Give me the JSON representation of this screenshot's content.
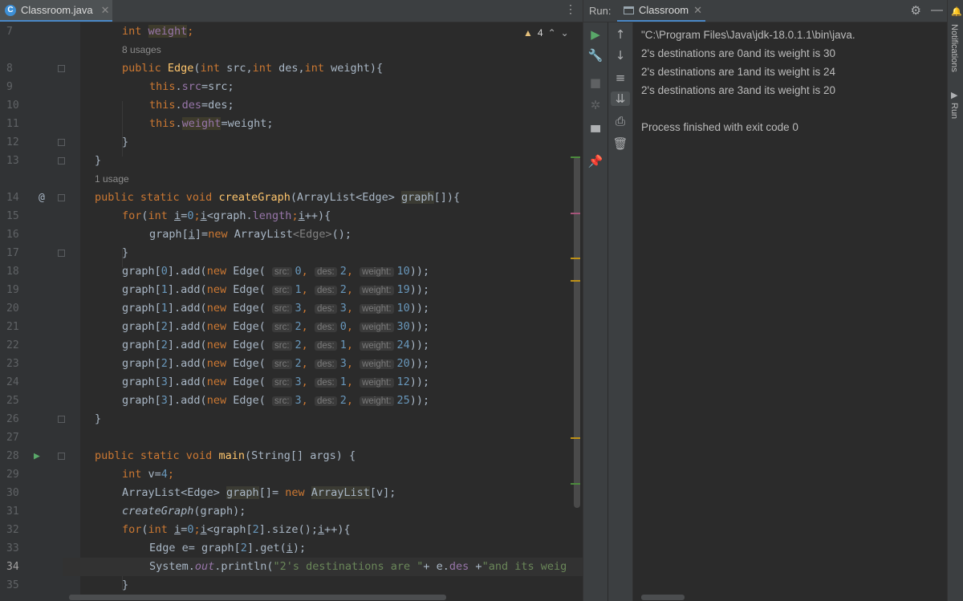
{
  "editor": {
    "tab_label": "Classroom.java",
    "tab_icon": "c-class-icon",
    "warnings": "4",
    "line_numbers": [
      "7",
      "8",
      "9",
      "10",
      "11",
      "12",
      "13",
      "14",
      "15",
      "16",
      "17",
      "18",
      "19",
      "20",
      "21",
      "22",
      "23",
      "24",
      "25",
      "26",
      "27",
      "28",
      "29",
      "30",
      "31",
      "32",
      "33",
      "34",
      "35"
    ],
    "hint_usages_edge": "8 usages",
    "hint_usages_create": "1 usage",
    "code": {
      "l7_kw": "int ",
      "l7_id": "weight",
      "l7_end": ";",
      "l8_a": "public ",
      "l8_fn": "Edge",
      "l8_b": "(",
      "l8_c": "int ",
      "l8_d": "src,",
      "l8_e": "int ",
      "l8_f": "des,",
      "l8_g": "int ",
      "l8_h": "weight){",
      "this": "this",
      "l9_f": "src",
      "l9_r": "=src;",
      "l10_f": "des",
      "l10_r": "=des;",
      "l11_f": "weight",
      "l11_r": "=weight;",
      "close": "}",
      "l14_a": "public static void ",
      "l14_fn": "createGraph",
      "l14_b": "(ArrayList<Edge> ",
      "l14_c": "graph",
      "l14_d": "[]){",
      "l15_a": "for",
      "l15_b": "(",
      "l15_c": "int ",
      "l15_i": "i",
      "l15_d": "=",
      "l15_e": "0",
      "l15_f": ";",
      "l15_g": "<graph.",
      "l15_len": "length",
      "l15_h": ";",
      "l15_j": "++){",
      "l16_a": "graph[",
      "l16_b": "]=",
      "l16_new": "new ",
      "l16_c": "ArrayList",
      "l16_g": "<Edge>",
      "l16_d": "();",
      "add_rows": [
        {
          "g": "0",
          "s": "0",
          "d": "2",
          "w": "10"
        },
        {
          "g": "1",
          "s": "1",
          "d": "2",
          "w": "19"
        },
        {
          "g": "1",
          "s": "3",
          "d": "3",
          "w": "10"
        },
        {
          "g": "2",
          "s": "2",
          "d": "0",
          "w": "30"
        },
        {
          "g": "2",
          "s": "2",
          "d": "1",
          "w": "24"
        },
        {
          "g": "2",
          "s": "2",
          "d": "3",
          "w": "20"
        },
        {
          "g": "3",
          "s": "3",
          "d": "1",
          "w": "12"
        },
        {
          "g": "3",
          "s": "3",
          "d": "2",
          "w": "25"
        }
      ],
      "p_graph": "graph[",
      "p_add": "].add(",
      "p_new": "new ",
      "p_edge": "Edge( ",
      "hint_src": "src:",
      "hint_des": "des:",
      "hint_weight": "weight:",
      "comma": ", ",
      "p_end": "));",
      "l28_a": "public static void ",
      "l28_fn": "main",
      "l28_b": "(String[] args) {",
      "l29_kw": "int ",
      "l29_b": "v=",
      "l29_n": "4",
      "l29_e": ";",
      "l30_a": "ArrayList<Edge> ",
      "l30_b": "graph",
      "l30_c": "[]= ",
      "l30_new": "new ",
      "l30_d": "ArrayList",
      "l30_e": "[v];",
      "l31_a": "createGraph",
      "l31_b": "(graph);",
      "l32_a": "for",
      "l32_b": "(",
      "l32_c": "int ",
      "l32_i": "i",
      "l32_d": "=",
      "l32_e": "0",
      "l32_f": ";",
      "l32_g": "<graph[",
      "l32_h": "2",
      "l32_k": "].size();",
      "l32_j": "++){",
      "l33_a": "Edge e= graph[",
      "l33_b": "2",
      "l33_c": "].get(",
      "l33_i": "i",
      "l33_d": ");",
      "l34_a": "System.",
      "l34_out": "out",
      "l34_b": ".println(",
      "l34_str": "\"2's destinations are \"",
      "l34_c": "+ e.",
      "l34_des": "des",
      "l34_d": " +",
      "l34_str2": "\"and its weig",
      "l35": "}"
    }
  },
  "run": {
    "label": "Run:",
    "tab_label": "Classroom",
    "console_lines": [
      "\"C:\\Program Files\\Java\\jdk-18.0.1.1\\bin\\java.",
      "2's destinations are 0and its weight is 30",
      "2's destinations are 1and its weight is 24",
      "2's destinations are 3and its weight is 20",
      "",
      "Process finished with exit code 0"
    ]
  },
  "side_strip": {
    "notifications": "Notifications",
    "run": "Run"
  },
  "colors": {
    "background": "#2b2b2b",
    "keyword": "#cc7832",
    "method": "#ffc66d",
    "field": "#9876aa",
    "number": "#6897bb",
    "string": "#6a8759"
  }
}
